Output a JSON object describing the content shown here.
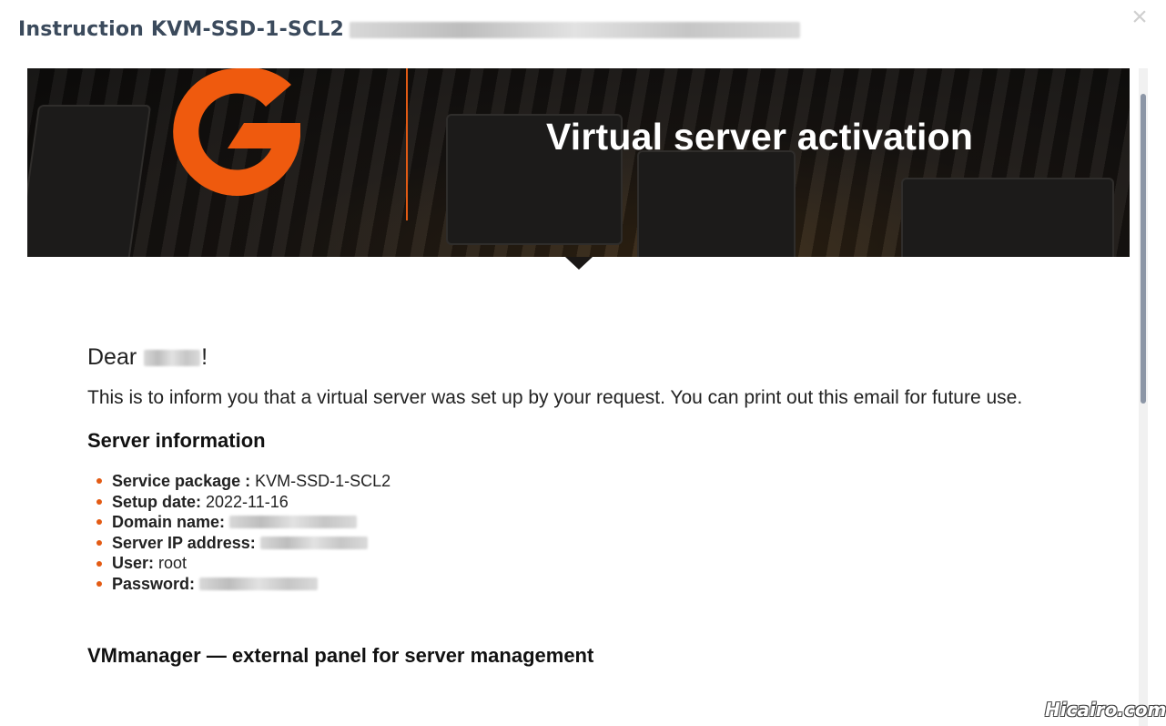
{
  "modal": {
    "title": "Instruction KVM-SSD-1-SCL2",
    "close_glyph": "×"
  },
  "banner": {
    "title": "Virtual server activation",
    "logo_icon": "orange-g-logo",
    "accent_color": "#e35b14"
  },
  "letter": {
    "greeting_prefix": "Dear",
    "greeting_suffix": "!",
    "intro": "This is to inform you that a virtual server was set up by your request. You can print out this email for future use.",
    "server_info_title": "Server information",
    "server_info": [
      {
        "label": "Service package :",
        "value": "KVM-SSD-1-SCL2"
      },
      {
        "label": "Setup date:",
        "value": "2022-11-16"
      },
      {
        "label": "Domain name:",
        "value": ""
      },
      {
        "label": "Server IP address:",
        "value": ""
      },
      {
        "label": "User:",
        "value": "root"
      },
      {
        "label": "Password:",
        "value": ""
      }
    ],
    "vmmanager_title": "VMmanager — external panel for server management"
  },
  "watermark": {
    "text": "Hicairo.com"
  },
  "colors": {
    "bullet": "#e35b14",
    "title_text": "#3b4a5c",
    "scroll_thumb": "#8c96a6"
  }
}
